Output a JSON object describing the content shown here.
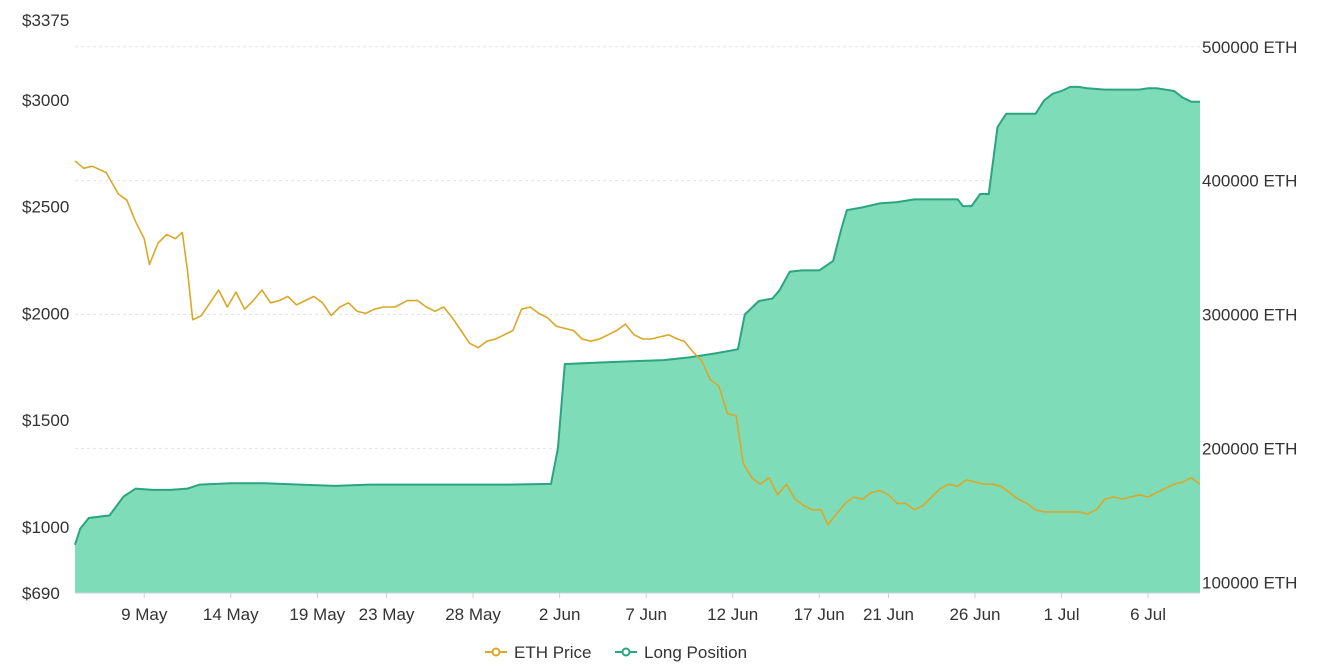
{
  "chart_data": {
    "type": "area",
    "title": "",
    "y_left": {
      "ticks": [
        "$3375",
        "$3000",
        "$2500",
        "$2000",
        "$1500",
        "$1000",
        "$690"
      ],
      "tick_values": [
        3375,
        3000,
        2500,
        2000,
        1500,
        1000,
        690
      ],
      "range": [
        690,
        3375
      ]
    },
    "y_right": {
      "ticks": [
        "500000 ETH",
        "400000 ETH",
        "300000 ETH",
        "200000 ETH",
        "100000 ETH"
      ],
      "tick_values": [
        500000,
        400000,
        300000,
        200000,
        100000
      ],
      "range": [
        92000,
        520000
      ]
    },
    "x_axis": {
      "ticks": [
        {
          "label": "9 May",
          "day": 9
        },
        {
          "label": "14 May",
          "day": 14
        },
        {
          "label": "19 May",
          "day": 19
        },
        {
          "label": "23 May",
          "day": 23
        },
        {
          "label": "28 May",
          "day": 28
        },
        {
          "label": "2 Jun",
          "day": 33
        },
        {
          "label": "7 Jun",
          "day": 38
        },
        {
          "label": "12 Jun",
          "day": 43
        },
        {
          "label": "17 Jun",
          "day": 48
        },
        {
          "label": "21 Jun",
          "day": 52
        },
        {
          "label": "26 Jun",
          "day": 57
        },
        {
          "label": "1 Jul",
          "day": 62
        },
        {
          "label": "6 Jul",
          "day": 67
        }
      ],
      "range_days": [
        5,
        70
      ]
    },
    "grid": true,
    "legend_position": "bottom-center",
    "series": [
      {
        "name": "ETH Price",
        "color": "#d9a828",
        "axis": "left",
        "points": [
          [
            5.0,
            2715
          ],
          [
            5.5,
            2680
          ],
          [
            6.0,
            2690
          ],
          [
            6.8,
            2660
          ],
          [
            7.5,
            2560
          ],
          [
            8.0,
            2530
          ],
          [
            8.5,
            2430
          ],
          [
            9.0,
            2350
          ],
          [
            9.3,
            2230
          ],
          [
            9.8,
            2330
          ],
          [
            10.3,
            2370
          ],
          [
            10.8,
            2350
          ],
          [
            11.2,
            2380
          ],
          [
            11.5,
            2200
          ],
          [
            11.8,
            1970
          ],
          [
            12.3,
            1990
          ],
          [
            12.8,
            2050
          ],
          [
            13.3,
            2110
          ],
          [
            13.8,
            2030
          ],
          [
            14.3,
            2100
          ],
          [
            14.8,
            2020
          ],
          [
            15.3,
            2060
          ],
          [
            15.8,
            2110
          ],
          [
            16.3,
            2050
          ],
          [
            16.8,
            2060
          ],
          [
            17.3,
            2080
          ],
          [
            17.8,
            2040
          ],
          [
            18.3,
            2060
          ],
          [
            18.8,
            2080
          ],
          [
            19.3,
            2050
          ],
          [
            19.8,
            1990
          ],
          [
            20.3,
            2030
          ],
          [
            20.8,
            2050
          ],
          [
            21.3,
            2010
          ],
          [
            21.8,
            2000
          ],
          [
            22.3,
            2020
          ],
          [
            22.8,
            2030
          ],
          [
            23.5,
            2030
          ],
          [
            24.2,
            2060
          ],
          [
            24.8,
            2060
          ],
          [
            25.3,
            2030
          ],
          [
            25.8,
            2010
          ],
          [
            26.3,
            2030
          ],
          [
            26.8,
            1980
          ],
          [
            27.3,
            1920
          ],
          [
            27.8,
            1860
          ],
          [
            28.3,
            1840
          ],
          [
            28.8,
            1870
          ],
          [
            29.3,
            1880
          ],
          [
            29.8,
            1900
          ],
          [
            30.3,
            1920
          ],
          [
            30.8,
            2020
          ],
          [
            31.3,
            2030
          ],
          [
            31.8,
            2000
          ],
          [
            32.3,
            1980
          ],
          [
            32.8,
            1940
          ],
          [
            33.3,
            1930
          ],
          [
            33.8,
            1920
          ],
          [
            34.3,
            1880
          ],
          [
            34.8,
            1870
          ],
          [
            35.3,
            1880
          ],
          [
            35.8,
            1900
          ],
          [
            36.3,
            1920
          ],
          [
            36.8,
            1950
          ],
          [
            37.3,
            1900
          ],
          [
            37.8,
            1880
          ],
          [
            38.3,
            1880
          ],
          [
            38.8,
            1890
          ],
          [
            39.3,
            1900
          ],
          [
            39.8,
            1880
          ],
          [
            40.2,
            1870
          ],
          [
            40.7,
            1820
          ],
          [
            41.2,
            1780
          ],
          [
            41.7,
            1690
          ],
          [
            42.2,
            1660
          ],
          [
            42.7,
            1530
          ],
          [
            43.2,
            1520
          ],
          [
            43.6,
            1300
          ],
          [
            44.1,
            1230
          ],
          [
            44.6,
            1200
          ],
          [
            45.1,
            1230
          ],
          [
            45.6,
            1150
          ],
          [
            46.1,
            1200
          ],
          [
            46.6,
            1130
          ],
          [
            47.1,
            1100
          ],
          [
            47.6,
            1080
          ],
          [
            48.1,
            1080
          ],
          [
            48.5,
            1010
          ],
          [
            49.0,
            1060
          ],
          [
            49.5,
            1110
          ],
          [
            50.0,
            1140
          ],
          [
            50.5,
            1130
          ],
          [
            51.0,
            1160
          ],
          [
            51.5,
            1170
          ],
          [
            52.0,
            1150
          ],
          [
            52.5,
            1110
          ],
          [
            53.0,
            1110
          ],
          [
            53.5,
            1080
          ],
          [
            54.0,
            1100
          ],
          [
            54.5,
            1140
          ],
          [
            55.0,
            1180
          ],
          [
            55.5,
            1200
          ],
          [
            56.0,
            1190
          ],
          [
            56.5,
            1220
          ],
          [
            57.0,
            1210
          ],
          [
            57.5,
            1200
          ],
          [
            58.0,
            1200
          ],
          [
            58.5,
            1190
          ],
          [
            59.0,
            1160
          ],
          [
            59.5,
            1130
          ],
          [
            60.0,
            1110
          ],
          [
            60.5,
            1080
          ],
          [
            61.0,
            1070
          ],
          [
            61.5,
            1070
          ],
          [
            62.0,
            1070
          ],
          [
            62.5,
            1070
          ],
          [
            63.0,
            1070
          ],
          [
            63.5,
            1060
          ],
          [
            64.0,
            1080
          ],
          [
            64.5,
            1130
          ],
          [
            65.0,
            1140
          ],
          [
            65.5,
            1130
          ],
          [
            66.0,
            1140
          ],
          [
            66.5,
            1150
          ],
          [
            67.0,
            1140
          ],
          [
            67.5,
            1160
          ],
          [
            68.0,
            1180
          ],
          [
            68.5,
            1200
          ],
          [
            69.0,
            1210
          ],
          [
            69.5,
            1230
          ],
          [
            70.0,
            1200
          ]
        ]
      },
      {
        "name": "Long Position",
        "color": "#2aa57f",
        "fill": "#7fdcb8",
        "axis": "right",
        "points": [
          [
            5.0,
            128000
          ],
          [
            5.3,
            140000
          ],
          [
            5.8,
            148000
          ],
          [
            7.0,
            150000
          ],
          [
            7.8,
            164000
          ],
          [
            8.5,
            170000
          ],
          [
            9.5,
            169000
          ],
          [
            10.5,
            169000
          ],
          [
            11.5,
            170000
          ],
          [
            12.2,
            173000
          ],
          [
            14.0,
            174000
          ],
          [
            16.0,
            174000
          ],
          [
            18.0,
            173000
          ],
          [
            20.0,
            172000
          ],
          [
            22.0,
            173000
          ],
          [
            24.0,
            173000
          ],
          [
            26.0,
            173000
          ],
          [
            28.0,
            173000
          ],
          [
            30.0,
            173000
          ],
          [
            32.5,
            173500
          ],
          [
            32.9,
            200000
          ],
          [
            33.3,
            263000
          ],
          [
            35.0,
            264000
          ],
          [
            37.0,
            265000
          ],
          [
            39.0,
            266000
          ],
          [
            40.5,
            268000
          ],
          [
            42.0,
            271000
          ],
          [
            43.3,
            274000
          ],
          [
            43.7,
            300000
          ],
          [
            44.5,
            310000
          ],
          [
            45.3,
            312000
          ],
          [
            45.7,
            318000
          ],
          [
            46.3,
            332000
          ],
          [
            47.0,
            333000
          ],
          [
            48.0,
            333000
          ],
          [
            48.8,
            340000
          ],
          [
            49.3,
            365000
          ],
          [
            49.6,
            378000
          ],
          [
            50.5,
            380000
          ],
          [
            51.5,
            383000
          ],
          [
            52.5,
            384000
          ],
          [
            53.5,
            386000
          ],
          [
            55.0,
            386000
          ],
          [
            56.0,
            386000
          ],
          [
            56.3,
            381000
          ],
          [
            56.8,
            381000
          ],
          [
            57.3,
            390000
          ],
          [
            57.8,
            390000
          ],
          [
            58.3,
            440000
          ],
          [
            58.8,
            450000
          ],
          [
            59.5,
            450000
          ],
          [
            60.5,
            450000
          ],
          [
            61.0,
            460000
          ],
          [
            61.5,
            465000
          ],
          [
            62.0,
            467000
          ],
          [
            62.5,
            470000
          ],
          [
            63.0,
            470000
          ],
          [
            63.5,
            469000
          ],
          [
            64.5,
            468000
          ],
          [
            65.5,
            468000
          ],
          [
            66.5,
            468000
          ],
          [
            67.0,
            469000
          ],
          [
            67.5,
            469000
          ],
          [
            68.0,
            468000
          ],
          [
            68.5,
            467000
          ],
          [
            69.0,
            462000
          ],
          [
            69.5,
            459000
          ],
          [
            70.0,
            459000
          ]
        ]
      }
    ]
  }
}
